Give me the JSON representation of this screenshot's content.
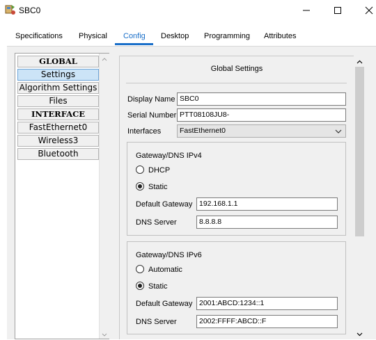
{
  "window": {
    "title": "SBC0",
    "minimize_glyph": "—",
    "maximize_glyph": "☐",
    "close_glyph": "✕"
  },
  "tabs": [
    {
      "label": "Specifications",
      "active": false
    },
    {
      "label": "Physical",
      "active": false
    },
    {
      "label": "Config",
      "active": true
    },
    {
      "label": "Desktop",
      "active": false
    },
    {
      "label": "Programming",
      "active": false
    },
    {
      "label": "Attributes",
      "active": false
    }
  ],
  "sidebar": {
    "items": [
      {
        "label": "GLOBAL",
        "type": "header"
      },
      {
        "label": "Settings",
        "type": "item",
        "selected": true
      },
      {
        "label": "Algorithm Settings",
        "type": "item"
      },
      {
        "label": "Files",
        "type": "item"
      },
      {
        "label": "INTERFACE",
        "type": "header"
      },
      {
        "label": "FastEthernet0",
        "type": "item"
      },
      {
        "label": "Wireless3",
        "type": "item"
      },
      {
        "label": "Bluetooth",
        "type": "item"
      }
    ]
  },
  "settings": {
    "title": "Global Settings",
    "display_name_label": "Display Name",
    "display_name": "SBC0",
    "serial_label": "Serial Number",
    "serial": "PTT08108JU8-",
    "interfaces_label": "Interfaces",
    "interface_selected": "FastEthernet0",
    "ipv4": {
      "title": "Gateway/DNS IPv4",
      "dhcp_label": "DHCP",
      "static_label": "Static",
      "selected": "Static",
      "gateway_label": "Default Gateway",
      "gateway": "192.168.1.1",
      "dns_label": "DNS Server",
      "dns": "8.8.8.8"
    },
    "ipv6": {
      "title": "Gateway/DNS IPv6",
      "auto_label": "Automatic",
      "static_label": "Static",
      "selected": "Static",
      "gateway_label": "Default Gateway",
      "gateway": "2001:ABCD:1234::1",
      "dns_label": "DNS Server",
      "dns": "2002:FFFF:ABCD::F"
    }
  },
  "colors": {
    "accent": "#1a6fc9",
    "selection": "#cce4f7"
  }
}
